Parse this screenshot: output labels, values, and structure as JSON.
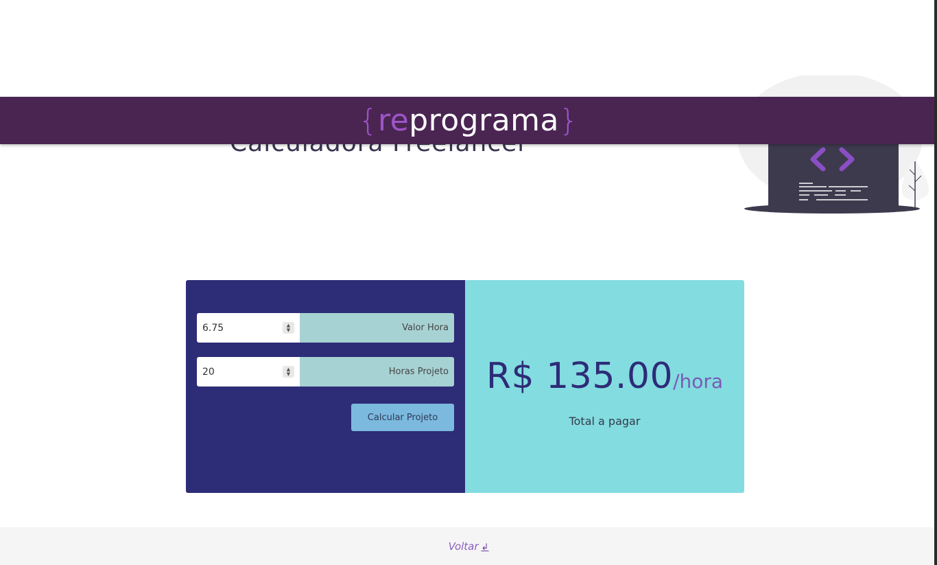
{
  "header": {
    "logo": {
      "brace_open": "{",
      "prefix": "re",
      "suffix": "programa",
      "brace_close": "}"
    }
  },
  "page_title": "Calculadora Freelancer",
  "illustration": {
    "icon": "laptop-code-icon"
  },
  "form": {
    "hourly_rate": {
      "value": "6.75",
      "label": "Valor Hora"
    },
    "project_hours": {
      "value": "20",
      "label": "Horas Projeto"
    },
    "calculate_button": "Calcular Projeto"
  },
  "result": {
    "value": "R$ 135.00",
    "unit": "/hora",
    "label": "Total a pagar"
  },
  "footer": {
    "back_label": "Voltar",
    "back_icon": "↲"
  },
  "colors": {
    "header_bg": "#4a2552",
    "card_left_bg": "#2d2c77",
    "card_right_bg": "#83dce0",
    "label_bg": "#a7d2d3",
    "button_bg": "#7bb9de",
    "accent": "#9d55c9"
  }
}
